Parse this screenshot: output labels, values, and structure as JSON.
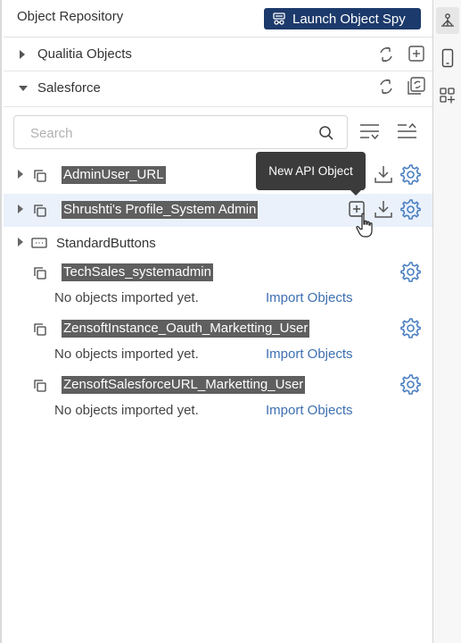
{
  "header": {
    "title": "Object Repository",
    "launch_spy_label": "Launch Object Spy"
  },
  "sections": [
    {
      "label": "Qualitia Objects",
      "expanded": false
    },
    {
      "label": "Salesforce",
      "expanded": true
    }
  ],
  "search": {
    "placeholder": "Search",
    "value": ""
  },
  "tooltip": {
    "text": "New API Object"
  },
  "tree": [
    {
      "label": "AdminUser_URL",
      "highlighted": true,
      "expandable": true
    },
    {
      "label": "Shrushti's Profile_System Admin",
      "highlighted": true,
      "expandable": true,
      "hovered": true
    },
    {
      "label": "StandardButtons",
      "highlighted": false,
      "expandable": true
    },
    {
      "label": "TechSales_systemadmin",
      "highlighted": true,
      "expandable": false,
      "empty_message": "No objects imported yet.",
      "import_link": "Import Objects"
    },
    {
      "label": "ZensoftInstance_Oauth_Marketting_User",
      "highlighted": true,
      "expandable": false,
      "empty_message": "No objects imported yet.",
      "import_link": "Import Objects"
    },
    {
      "label": "ZensoftSalesforceURL_Marketting_User",
      "highlighted": true,
      "expandable": false,
      "empty_message": "No objects imported yet.",
      "import_link": "Import Objects"
    }
  ],
  "icons": {
    "refresh": "refresh-icon",
    "add": "add-square-icon",
    "sync": "sync-copy-icon",
    "download": "download-icon",
    "settings": "gear-icon",
    "object": "copy-stack-icon",
    "standard": "buttons-icon"
  },
  "colors": {
    "accent": "#1c3a6b",
    "link": "#3d6fb1",
    "icon_blue": "#4a7fc1",
    "highlight": "#5f5f5f",
    "hover_row": "#eaf1fb",
    "tooltip_bg": "#3b3b3b"
  }
}
